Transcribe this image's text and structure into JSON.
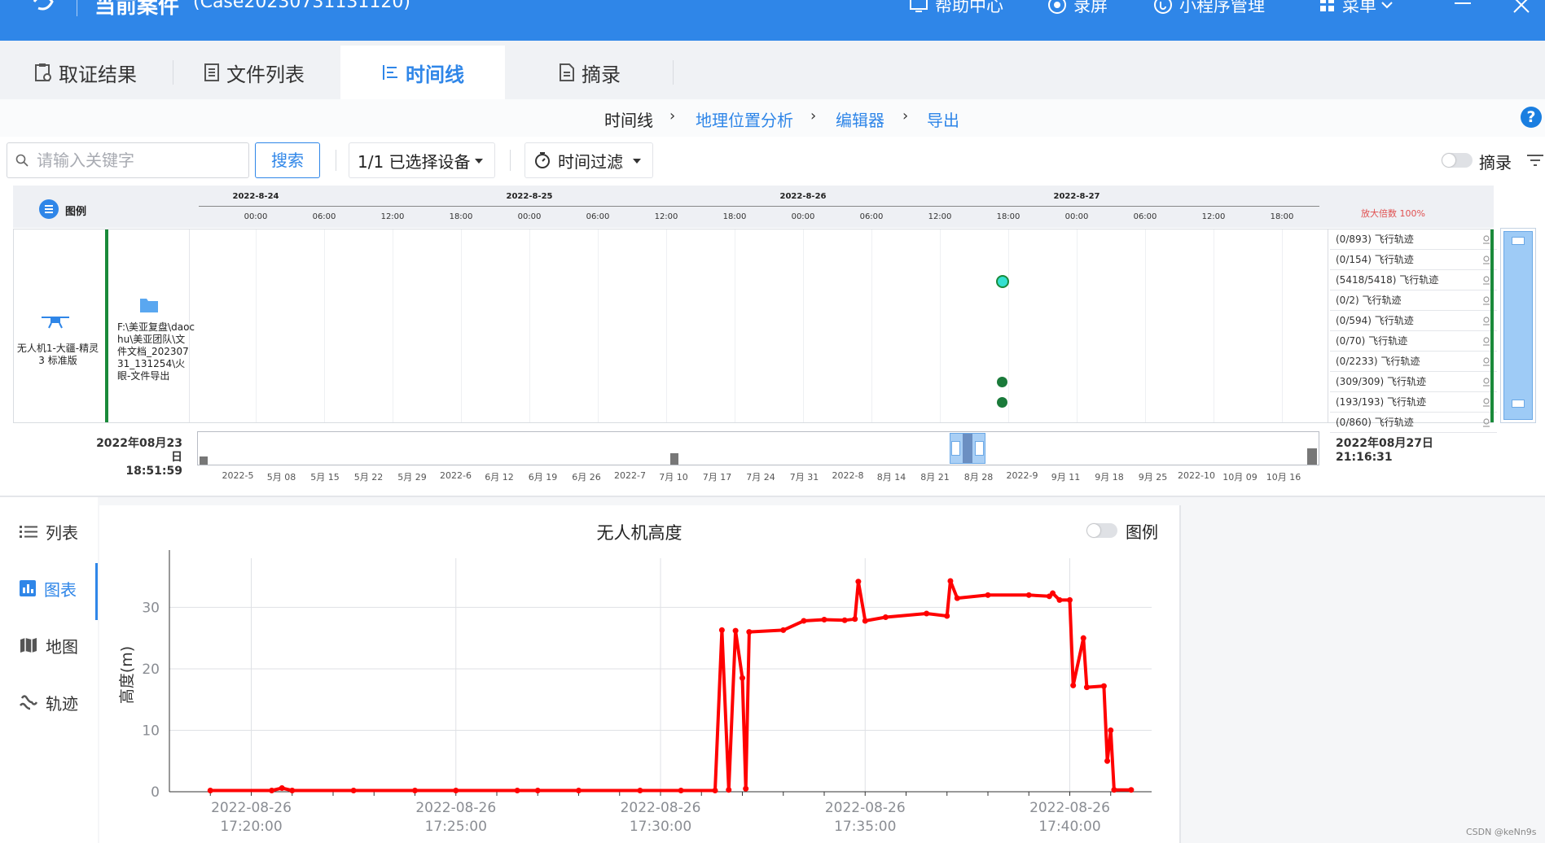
{
  "titlebar": {
    "title": "当前案件",
    "case_id": "(Case20230731131120)",
    "help": "帮助中心",
    "record": "录屏",
    "miniprogram": "小程序管理",
    "menu": "菜单"
  },
  "tabs": [
    {
      "label": "取证结果",
      "icon": "clipboard-check-icon"
    },
    {
      "label": "文件列表",
      "icon": "document-list-icon"
    },
    {
      "label": "时间线",
      "icon": "timeline-icon",
      "active": true
    },
    {
      "label": "摘录",
      "icon": "document-icon"
    }
  ],
  "breadcrumb": [
    "时间线",
    "地理位置分析",
    "编辑器",
    "导出"
  ],
  "toolbar": {
    "search_placeholder": "请输入关键字",
    "search_button": "搜索",
    "device_select": "1/1 已选择设备",
    "time_filter": "时间过滤",
    "excerpt_toggle": "摘录"
  },
  "timeline": {
    "legend_label": "图例",
    "dates": [
      "2022-8-24",
      "2022-8-25",
      "2022-8-26",
      "2022-8-27"
    ],
    "hours": [
      "00:00",
      "06:00",
      "12:00",
      "18:00",
      "00:00",
      "06:00",
      "12:00",
      "18:00",
      "00:00",
      "06:00",
      "12:00",
      "18:00",
      "00:00",
      "06:00",
      "12:00",
      "18:00"
    ],
    "zoom": "放大倍数 100%",
    "device_name": "无人机1-大疆-精灵 3 标准版",
    "file_path": "F:\\美亚复盘\\daochu\\美亚团队\\文件文档_20230731_131254\\火眼-文件导出",
    "tracks": [
      "(0/893) 飞行轨迹",
      "(0/154) 飞行轨迹",
      "(5418/5418) 飞行轨迹",
      "(0/2) 飞行轨迹",
      "(0/594) 飞行轨迹",
      "(0/70) 飞行轨迹",
      "(0/2233) 飞行轨迹",
      "(309/309) 飞行轨迹",
      "(193/193) 飞行轨迹",
      "(0/860) 飞行轨迹"
    ],
    "range_start": "2022年08月23日",
    "range_start_time": "18:51:59",
    "range_end": "2022年08月27日",
    "range_end_time": "21:16:31",
    "minimap_ticks": [
      "2022-5",
      "5月 08",
      "5月 15",
      "5月 22",
      "5月 29",
      "2022-6",
      "6月 12",
      "6月 19",
      "6月 26",
      "2022-7",
      "7月 10",
      "7月 17",
      "7月 24",
      "7月 31",
      "2022-8",
      "8月 14",
      "8月 21",
      "8月 28",
      "2022-9",
      "9月 11",
      "9月 18",
      "9月 25",
      "2022-10",
      "10月 09",
      "10月 16"
    ]
  },
  "side_menu": [
    {
      "label": "列表",
      "icon": "list-icon"
    },
    {
      "label": "图表",
      "icon": "bar-chart-icon",
      "active": true
    },
    {
      "label": "地图",
      "icon": "map-icon"
    },
    {
      "label": "轨迹",
      "icon": "track-icon"
    }
  ],
  "chart_legend_toggle": "图例",
  "watermark": "CSDN @keNn9s",
  "colors": {
    "accent": "#2f86e8",
    "series": "#ff0000",
    "event_dot": "#1a7a3a"
  },
  "chart_data": {
    "type": "line",
    "title": "无人机高度",
    "ylabel": "高度(m)",
    "xlabel": "",
    "ylim": [
      0,
      38
    ],
    "yticks": [
      0,
      10,
      20,
      30
    ],
    "xlim": [
      "2022-08-26 17:18:00",
      "2022-08-26 17:42:00"
    ],
    "xticks": [
      {
        "date": "2022-08-26",
        "time": "17:20:00"
      },
      {
        "date": "2022-08-26",
        "time": "17:25:00"
      },
      {
        "date": "2022-08-26",
        "time": "17:30:00"
      },
      {
        "date": "2022-08-26",
        "time": "17:35:00"
      },
      {
        "date": "2022-08-26",
        "time": "17:40:00"
      }
    ],
    "grid": true,
    "series": [
      {
        "color": "#ff0000",
        "points": [
          [
            "17:19:00",
            0.2
          ],
          [
            "17:20:30",
            0.2
          ],
          [
            "17:20:45",
            0.6
          ],
          [
            "17:21:00",
            0.2
          ],
          [
            "17:22:30",
            0.2
          ],
          [
            "17:24:00",
            0.2
          ],
          [
            "17:25:00",
            0.2
          ],
          [
            "17:26:30",
            0.2
          ],
          [
            "17:27:00",
            0.2
          ],
          [
            "17:28:00",
            0.2
          ],
          [
            "17:29:30",
            0.2
          ],
          [
            "17:30:30",
            0.2
          ],
          [
            "17:31:20",
            0.2
          ],
          [
            "17:31:30",
            26.3
          ],
          [
            "17:31:40",
            0.3
          ],
          [
            "17:31:50",
            26.2
          ],
          [
            "17:32:00",
            18.5
          ],
          [
            "17:32:05",
            0.5
          ],
          [
            "17:32:10",
            26.0
          ],
          [
            "17:33:00",
            26.3
          ],
          [
            "17:33:30",
            27.8
          ],
          [
            "17:34:00",
            28.0
          ],
          [
            "17:34:30",
            27.9
          ],
          [
            "17:34:45",
            28.1
          ],
          [
            "17:34:50",
            34.2
          ],
          [
            "17:35:00",
            27.8
          ],
          [
            "17:35:30",
            28.4
          ],
          [
            "17:36:30",
            29.0
          ],
          [
            "17:37:00",
            28.6
          ],
          [
            "17:37:05",
            34.3
          ],
          [
            "17:37:15",
            31.5
          ],
          [
            "17:38:00",
            32.0
          ],
          [
            "17:39:00",
            32.0
          ],
          [
            "17:39:30",
            31.8
          ],
          [
            "17:39:35",
            32.3
          ],
          [
            "17:39:45",
            31.2
          ],
          [
            "17:40:00",
            31.2
          ],
          [
            "17:40:05",
            17.3
          ],
          [
            "17:40:20",
            25.0
          ],
          [
            "17:40:25",
            17.0
          ],
          [
            "17:40:50",
            17.2
          ],
          [
            "17:40:55",
            5.0
          ],
          [
            "17:41:00",
            10.0
          ],
          [
            "17:41:05",
            0.3
          ],
          [
            "17:41:30",
            0.3
          ]
        ]
      }
    ]
  }
}
